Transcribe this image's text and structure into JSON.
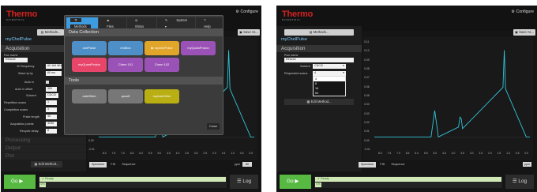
{
  "brand": {
    "name": "Thermo",
    "sub": "SCIENTIFIC"
  },
  "header": {
    "configure": "Configure"
  },
  "sidebar": {
    "methods_button": "Methods...",
    "app_name": "myChelPulse",
    "sections": {
      "acquisition": "Acquisition",
      "processing": "Processing",
      "output": "Output",
      "plot": "Plot"
    },
    "edit_method": "Edit Method..."
  },
  "left_params": [
    {
      "label": "Run name",
      "value": "Ethanol"
    },
    {
      "label": "1H frequency",
      "value": "60.184 MHz"
    },
    {
      "label": "Wave ty by",
      "value": "60 ms"
    },
    {
      "label": "Auto rx",
      "value": ""
    },
    {
      "label": "Auto rx offset",
      "value": "300"
    },
    {
      "label": "Solvent",
      "value": "CDCl3"
    },
    {
      "label": "Repetition scans",
      "value": "1"
    },
    {
      "label": "Completion scans",
      "value": "1"
    },
    {
      "label": "Pulse length",
      "value": "40"
    },
    {
      "label": "Acquisition points",
      "value": "4096"
    },
    {
      "label": "Recycle delay",
      "value": "8"
    }
  ],
  "right_params": {
    "run_name_label": "Run name",
    "run_name_value": "Ethanol",
    "solvent_label": "Solvent",
    "solvent_value": "CDCl3",
    "scans_label": "Requested scans",
    "scans_value": "4",
    "scan_options": [
      "4",
      "8",
      "16",
      "64"
    ]
  },
  "plot": {
    "save_as": "Save As...",
    "tabs": [
      "Spectrum",
      "FID",
      "Sequence"
    ],
    "zoom_label": "ppm",
    "zoom_value": "80",
    "y_ticks": [
      "0.11",
      "0.10",
      "0.09",
      "0.08",
      "0.07",
      "0.06",
      "0.05",
      "0.04",
      "0.03",
      "0.02",
      "0.01",
      "0.00",
      "-0.01"
    ],
    "x_ticks": [
      "8.0",
      "7.5",
      "7.0",
      "6.5",
      "6.0",
      "5.5",
      "5.0",
      "4.5",
      "4.0",
      "3.5",
      "3.0",
      "2.5",
      "2.0",
      "1.5",
      "1.0",
      "0.5",
      "0.0"
    ]
  },
  "modal": {
    "tabs": [
      "Methods",
      "Files",
      "Shims",
      "System",
      "Help"
    ],
    "section_collection": "Data Collection",
    "collection_tiles": [
      {
        "label": "onePulse",
        "color": "#4f8fc8"
      },
      {
        "label": "nmMon",
        "color": "#4f8fc8"
      },
      {
        "label": "myOnePulse",
        "color": "#e1a52a"
      },
      {
        "label": "myQuickProton",
        "color": "#9b52b6"
      },
      {
        "label": "myQuantProton",
        "color": "#e7456a"
      },
      {
        "label": "Chem 101",
        "color": "#9b52b6"
      },
      {
        "label": "Chem 102",
        "color": "#9b52b6"
      }
    ],
    "section_tools": "Tools",
    "tool_tiles": [
      {
        "label": "autoShim",
        "color": "#777777"
      },
      {
        "label": "qcsoft",
        "color": "#777777"
      },
      {
        "label": "myAutoShim",
        "color": "#b9ae12"
      }
    ],
    "close": "Close"
  },
  "footer": {
    "go": "Go",
    "ready": "Ready",
    "count": "0%",
    "log": "Log"
  },
  "chart_data": {
    "type": "line",
    "title": "",
    "xlabel": "ppm",
    "ylabel": "",
    "xlim": [
      8.3,
      -0.2
    ],
    "ylim": [
      -0.015,
      0.115
    ],
    "series": [
      {
        "x": [
          8.3,
          6.8,
          5.2,
          5.0,
          4.8,
          3.7,
          3.62,
          3.55,
          3.48,
          1.27,
          1.2,
          1.13,
          0.0,
          -0.2
        ],
        "y": [
          0.0,
          0.0,
          0.0,
          0.032,
          0.0,
          0.012,
          0.024,
          0.022,
          0.01,
          0.06,
          0.105,
          0.058,
          0.0,
          0.0
        ]
      }
    ]
  }
}
